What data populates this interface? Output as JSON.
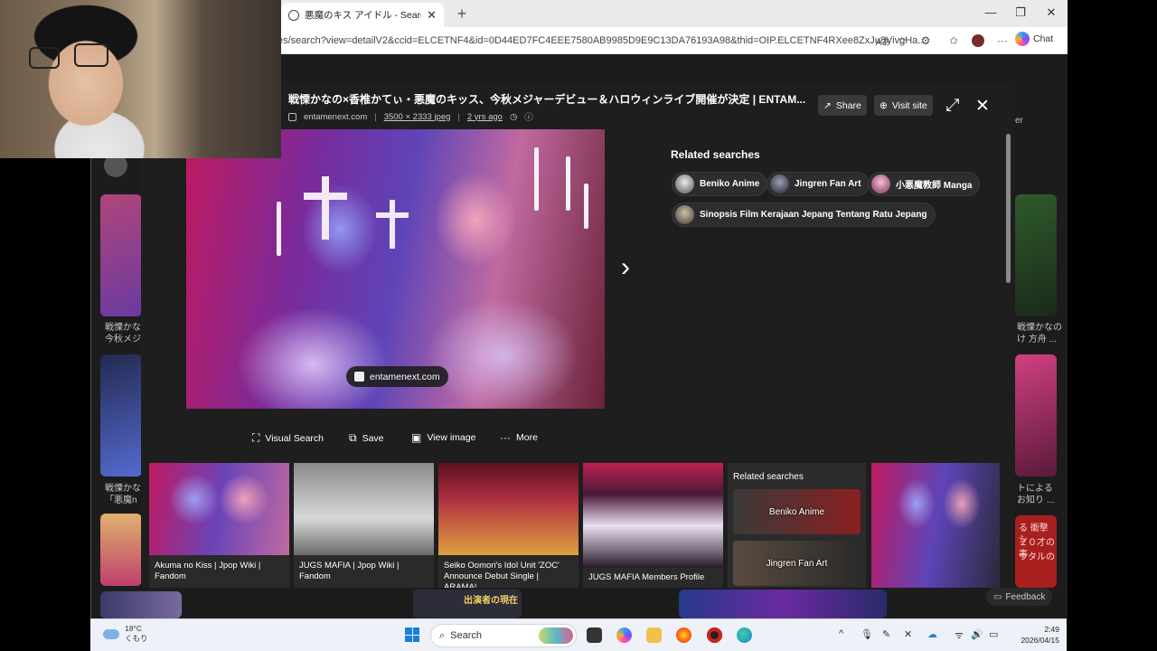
{
  "browser": {
    "tab_title": "悪魔のキス アイドル - Search images",
    "tab_close": "✕",
    "new_tab": "+",
    "url": "es/search?view=detailV2&ccid=ELCETNF4&id=0D44ED7FC4EEE7580AB9985D9E9C13DA76193A98&thid=OIP.ELCETNF4RXee8ZxJu8VivgHa...",
    "read_aloud": "Aあ",
    "chat_label": "Chat"
  },
  "overlay": {
    "title": "戦慄かなの×香椎かてぃ・悪魔のキッス、今秋メジャーデビュー＆ハロウィンライブ開催が決定 | ENTAM...",
    "source_domain": "entamenext.com",
    "dimensions": "3500 × 2333 jpeg",
    "age": "2 yrs ago",
    "share_label": "Share",
    "visit_label": "Visit site",
    "image_source_badge": "entamenext.com",
    "actions": {
      "visual_search": "Visual Search",
      "save": "Save",
      "view_image": "View image",
      "more": "More"
    },
    "related": {
      "title": "Related searches",
      "chips": [
        {
          "label": "Beniko Anime"
        },
        {
          "label": "Jingren Fan Art"
        },
        {
          "label": "小悪魔教師 Manga"
        },
        {
          "label": "Sinopsis Film Kerajaan Jepang Tentang Ratu Jepang"
        }
      ]
    },
    "strip": [
      {
        "caption": "Akuma no Kiss | Jpop Wiki | Fandom"
      },
      {
        "caption": "JUGS MAFIA | Jpop Wiki | Fandom"
      },
      {
        "caption": "Seiko Oomori's Idol Unit 'ZOC' Announce Debut Single | ARAMA!..."
      },
      {
        "caption": "JUGS MAFIA Members Profile"
      }
    ],
    "strip_related": {
      "title": "Related searches",
      "cards": [
        {
          "label": "Beniko Anime"
        },
        {
          "label": "Jingren Fan Art"
        }
      ]
    }
  },
  "background": {
    "left_texts": [
      "戦慄かな",
      "今秋メジ",
      "戦慄かな",
      "「悪魔n"
    ],
    "right_texts": [
      "戦慄かなの",
      "け 方舟 ...",
      "トによる",
      "お知り ..."
    ],
    "filter_label": "er",
    "bottom_text": "出演者の現在",
    "red_tile_text": [
      "る 衝撃 シ",
      "２０才の事",
      "ウタルの"
    ],
    "feedback": "Feedback"
  },
  "taskbar": {
    "weather_temp": "18°C",
    "weather_desc": "くもり",
    "search_label": "Search",
    "time": "2:49",
    "date": "2026/04/15"
  },
  "colors": {
    "accent": "#1a7fd8",
    "overlay_bg": "#1e1e1e"
  }
}
